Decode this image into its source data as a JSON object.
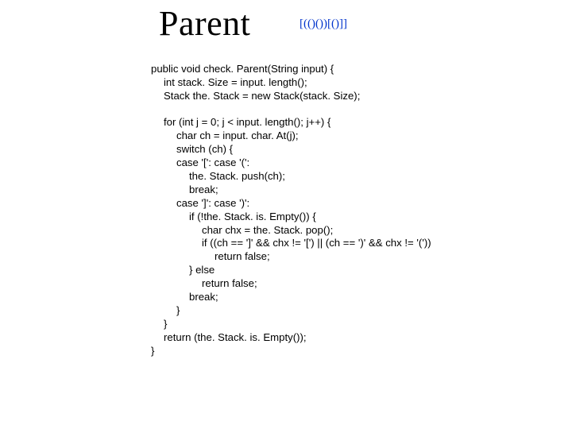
{
  "title": "Parent",
  "bracket_example": "[(()())[()]]",
  "code": [
    "public void check. Parent(String input) {",
    "int stack. Size = input. length();",
    "Stack the. Stack = new Stack(stack. Size);",
    "",
    "for (int j = 0; j < input. length(); j++) {",
    "char ch = input. char. At(j);",
    "switch (ch) {",
    "case '[': case '(':",
    "the. Stack. push(ch);",
    "break;",
    "case ']': case ')':",
    "if (!the. Stack. is. Empty()) {",
    "char chx = the. Stack. pop();",
    "if ((ch == ']' && chx != '[') || (ch == ')' && chx != '('))",
    "return false;",
    "} else",
    "return false;",
    "break;",
    "}",
    "}",
    "return (the. Stack. is. Empty());",
    "}"
  ]
}
